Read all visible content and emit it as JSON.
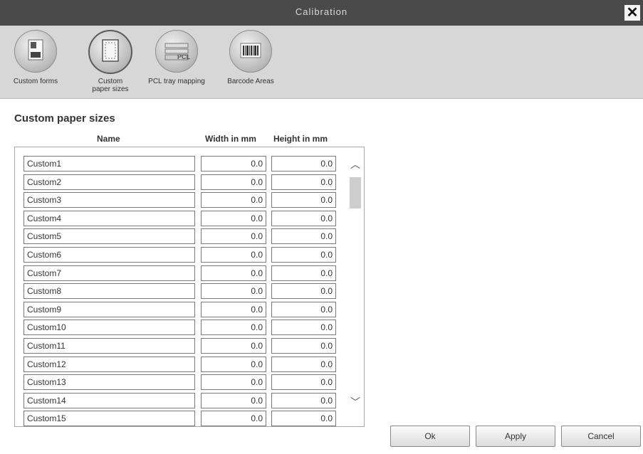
{
  "window": {
    "title": "Calibration",
    "close_glyph": "✕"
  },
  "toolbar": {
    "tools": [
      {
        "label": "Custom forms",
        "icon": "custom-forms-icon",
        "selected": false
      },
      {
        "label": "Custom paper sizes",
        "icon": "custom-paper-sizes-icon",
        "selected": true
      },
      {
        "label": "PCL tray mapping",
        "icon": "pcl-tray-mapping-icon",
        "selected": false
      },
      {
        "label": "Barcode Areas",
        "icon": "barcode-areas-icon",
        "selected": false
      }
    ],
    "pcl_badge": "PCL"
  },
  "section": {
    "title": "Custom paper sizes"
  },
  "table": {
    "columns": {
      "name": "Name",
      "width": "Width in mm",
      "height": "Height in mm"
    },
    "rows": [
      {
        "name": "Custom1",
        "width": "0.0",
        "height": "0.0"
      },
      {
        "name": "Custom2",
        "width": "0.0",
        "height": "0.0"
      },
      {
        "name": "Custom3",
        "width": "0.0",
        "height": "0.0"
      },
      {
        "name": "Custom4",
        "width": "0.0",
        "height": "0.0"
      },
      {
        "name": "Custom5",
        "width": "0.0",
        "height": "0.0"
      },
      {
        "name": "Custom6",
        "width": "0.0",
        "height": "0.0"
      },
      {
        "name": "Custom7",
        "width": "0.0",
        "height": "0.0"
      },
      {
        "name": "Custom8",
        "width": "0.0",
        "height": "0.0"
      },
      {
        "name": "Custom9",
        "width": "0.0",
        "height": "0.0"
      },
      {
        "name": "Custom10",
        "width": "0.0",
        "height": "0.0"
      },
      {
        "name": "Custom11",
        "width": "0.0",
        "height": "0.0"
      },
      {
        "name": "Custom12",
        "width": "0.0",
        "height": "0.0"
      },
      {
        "name": "Custom13",
        "width": "0.0",
        "height": "0.0"
      },
      {
        "name": "Custom14",
        "width": "0.0",
        "height": "0.0"
      },
      {
        "name": "Custom15",
        "width": "0.0",
        "height": "0.0"
      }
    ]
  },
  "scroll": {
    "up_glyph": "︿",
    "down_glyph": "﹀"
  },
  "buttons": {
    "ok": "Ok",
    "apply": "Apply",
    "cancel": "Cancel"
  }
}
